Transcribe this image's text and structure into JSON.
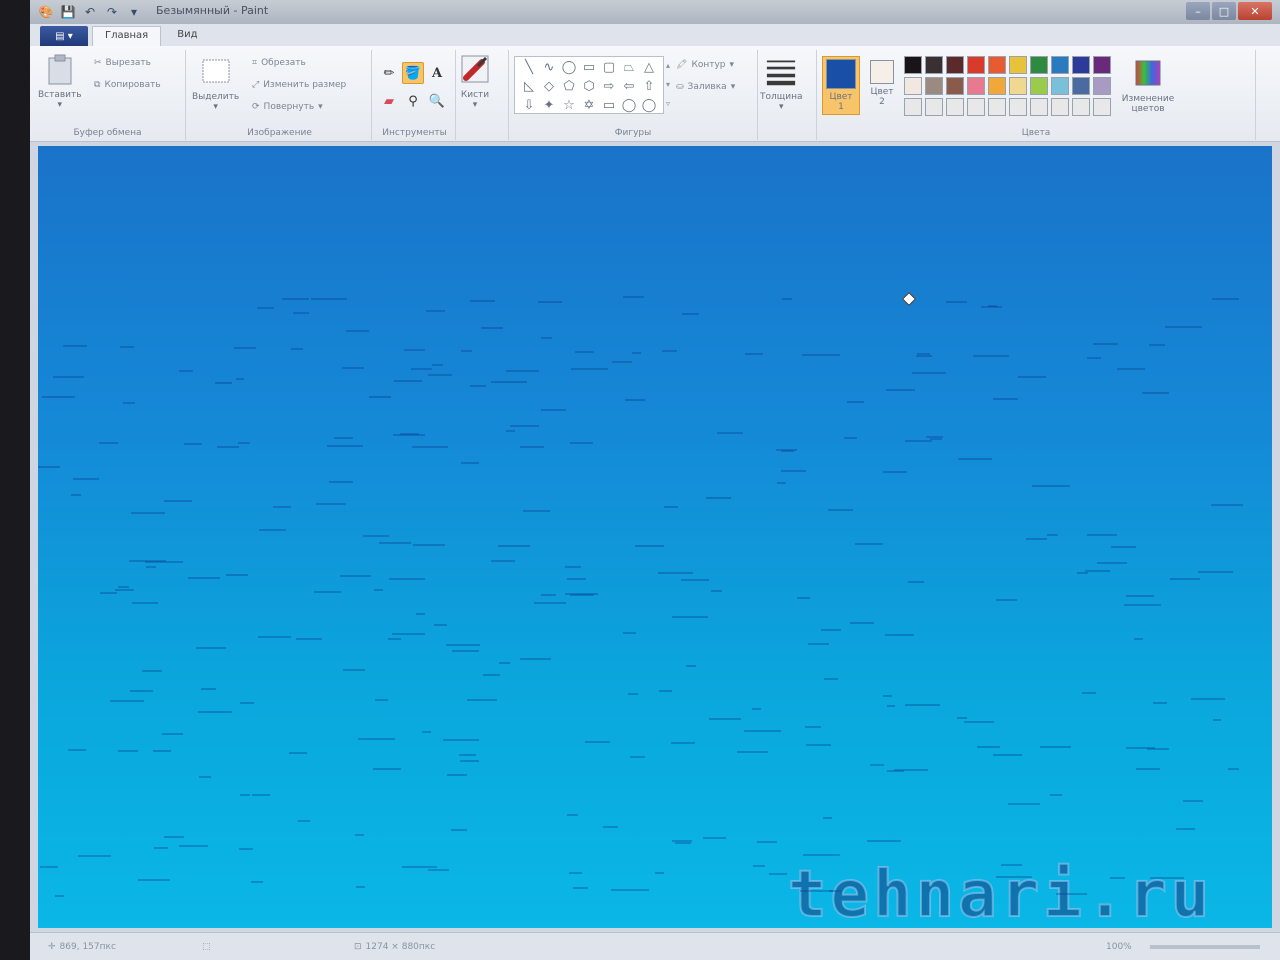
{
  "window": {
    "title": "Безымянный - Paint"
  },
  "tabs": [
    {
      "label": "Главная"
    },
    {
      "label": "Вид"
    }
  ],
  "clipboard": {
    "paste_label": "Вставить",
    "cut_label": "Вырезать",
    "copy_label": "Копировать",
    "group_label": "Буфер обмена"
  },
  "image": {
    "select_label": "Выделить",
    "crop_label": "Обрезать",
    "resize_label": "Изменить размер",
    "rotate_label": "Повернуть",
    "group_label": "Изображение"
  },
  "tools": {
    "group_label": "Инструменты",
    "brushes_label": "Кисти"
  },
  "shapes": {
    "group_label": "Фигуры",
    "outline_label": "Контур",
    "fill_label": "Заливка",
    "items": [
      "╲",
      "∿",
      "◯",
      "▭",
      "▢",
      "⏢",
      "△",
      "◺",
      "◇",
      "⬠",
      "⬡",
      "⇨",
      "⇦",
      "⇧",
      "⇩",
      "✦",
      "☆",
      "✡",
      "▭",
      "◯",
      "◯"
    ]
  },
  "size": {
    "label": "Толщина"
  },
  "colors": {
    "group_label": "Цвета",
    "color1_label": "Цвет 1",
    "color2_label": "Цвет 2",
    "edit_label": "Изменение цветов",
    "color1": "#1a4fa6",
    "color2": "#f5efe8",
    "palette_row1": [
      "#1b1416",
      "#3a3032",
      "#5c2a2a",
      "#d93a2a",
      "#e85a30",
      "#e8c23a",
      "#2e8a3e",
      "#2a7ac0",
      "#2e3a9a",
      "#6a2a7a"
    ],
    "palette_row2": [
      "#f2e8e0",
      "#9a8a80",
      "#8a5a4a",
      "#e87a90",
      "#f0a83a",
      "#f0d890",
      "#9acb4a",
      "#7ac0d8",
      "#4a6aa0",
      "#a89ac0"
    ],
    "palette_row3": [
      "#e8e8e8",
      "#e8e8e8",
      "#e8e8e8",
      "#e8e8e8",
      "#e8e8e8",
      "#e8e8e8",
      "#e8e8e8",
      "#e8e8e8",
      "#e8e8e8",
      "#e8e8e8"
    ]
  },
  "status": {
    "cursor_pos": "869, 157пкс",
    "canvas_size": "1274 × 880пкс",
    "zoom": "100%"
  },
  "watermark": "tehnari.ru"
}
